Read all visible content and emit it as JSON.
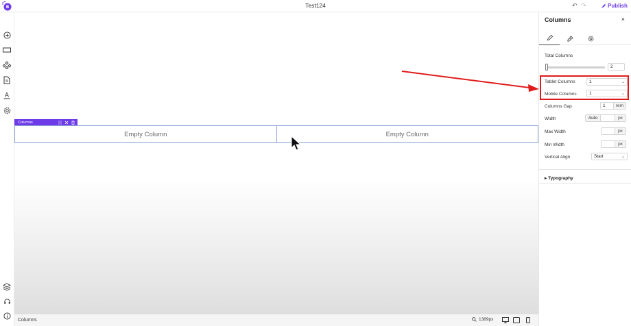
{
  "topbar": {
    "title": "Test124",
    "undo_icon": "undo-icon",
    "redo_icon": "redo-icon",
    "publish_label": "Publish"
  },
  "leftrail": {
    "icons": [
      "add-icon",
      "section-icon",
      "components-icon",
      "pages-icon",
      "typography-icon",
      "settings-icon",
      "layers-icon",
      "support-icon",
      "info-icon"
    ]
  },
  "canvas": {
    "block_label": "Columns",
    "columns": [
      "Empty Column",
      "Empty Column"
    ]
  },
  "bottombar": {
    "status": "Columns",
    "zoom": "1389px"
  },
  "panel": {
    "title": "Columns",
    "close": "×",
    "total_columns_label": "Total Columns",
    "total_columns_value": "2",
    "total_columns_slider": 0.0,
    "tablet_columns_label": "Tablet Columns",
    "tablet_columns_value": "1",
    "mobile_columns_label": "Mobile Columns",
    "mobile_columns_value": "1",
    "columns_gap_label": "Columns Gap",
    "columns_gap_value": "1",
    "columns_gap_unit": "rem",
    "width_label": "Width",
    "width_value": "Auto",
    "width_unit": "px",
    "max_width_label": "Max Width",
    "max_width_value": "",
    "max_width_unit": "px",
    "min_width_label": "Min Width",
    "min_width_value": "",
    "min_width_unit": "px",
    "vertical_align_label": "Vertical Align",
    "vertical_align_value": "Start",
    "typography_label": "Typography"
  },
  "colors": {
    "accent": "#6d3be8",
    "highlight": "#e01a1a",
    "column_border": "#8fa6d8"
  }
}
